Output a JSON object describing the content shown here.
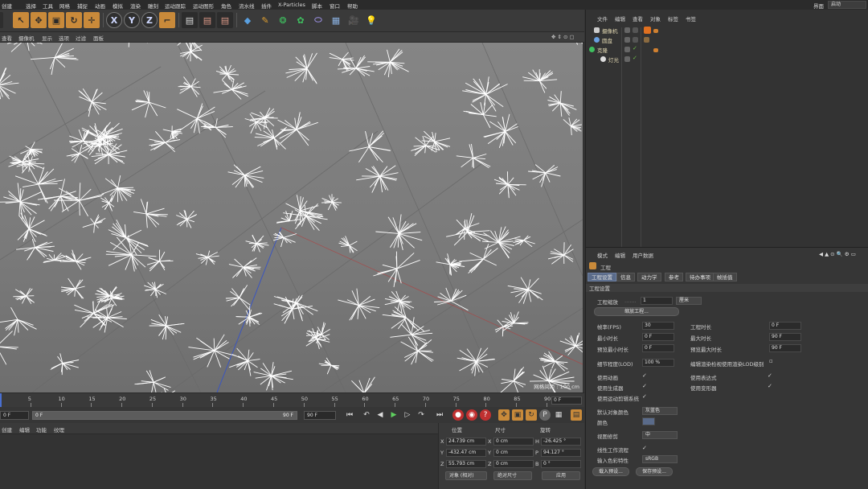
{
  "menubar": {
    "items": [
      "创建",
      "选择",
      "工具",
      "网格",
      "捕捉",
      "动画",
      "模拟",
      "渲染",
      "雕刻",
      "运动跟踪",
      "运动图形",
      "角色",
      "流水线",
      "插件",
      "X-Particles",
      "脚本",
      "窗口",
      "帮助"
    ],
    "layout_label": "界面",
    "layout_value": "启动"
  },
  "toolbar": {
    "axis_x": "X",
    "axis_y": "Y",
    "axis_z": "Z"
  },
  "viewport_menu": {
    "items": [
      "查看",
      "摄像机",
      "显示",
      "选项",
      "过滤",
      "面板"
    ]
  },
  "viewport": {
    "grid_scale": "网格间距 : 100 cm"
  },
  "timeline": {
    "ticks": [
      "0",
      "5",
      "10",
      "15",
      "20",
      "25",
      "30",
      "35",
      "40",
      "45",
      "50",
      "55",
      "60",
      "65",
      "70",
      "75",
      "80",
      "85",
      "90"
    ],
    "current_frame": "0 F"
  },
  "playbar": {
    "start_field": "0 F",
    "range_start": "0 F",
    "range_end": "90 F",
    "end_field": "90 F"
  },
  "material_menu": {
    "items": [
      "创建",
      "编辑",
      "功能",
      "纹理"
    ]
  },
  "coords": {
    "headers": [
      "位置",
      "尺寸",
      "旋转"
    ],
    "rows": [
      {
        "axis": "X",
        "pos": "24.739 cm",
        "size_axis": "X",
        "size": "0 cm",
        "rot_axis": "H",
        "rot": "-26.425 °"
      },
      {
        "axis": "Y",
        "pos": "-432.47 cm",
        "size_axis": "Y",
        "size": "0 cm",
        "rot_axis": "P",
        "rot": "94.127 °"
      },
      {
        "axis": "Z",
        "pos": "55.793 cm",
        "size_axis": "Z",
        "size": "0 cm",
        "rot_axis": "B",
        "rot": "0 °"
      }
    ],
    "mode_select": "对象 (相对)",
    "size_select": "绝对尺寸",
    "apply_button": "应用"
  },
  "object_manager": {
    "menu": [
      "文件",
      "编辑",
      "查看",
      "对象",
      "标签",
      "书签"
    ],
    "objects": [
      {
        "name": "摄像机"
      },
      {
        "name": "圆盘"
      },
      {
        "name": "克隆"
      },
      {
        "name": "灯光"
      }
    ]
  },
  "attributes": {
    "menu": [
      "模式",
      "编辑",
      "用户数据"
    ],
    "object_title": "工程",
    "tabs": [
      "工程设置",
      "信息",
      "动力学",
      "参考",
      "待办事项",
      "帧插值"
    ],
    "section": "工程设置",
    "scale_label": "工程缩放",
    "scale_value": "1",
    "scale_unit": "厘米",
    "scale_button": "缩放工程...",
    "fps_label": "帧率(FPS)",
    "fps_value": "30",
    "project_time_label": "工程时长",
    "project_time_value": "0 F",
    "min_time_label": "最小时长",
    "min_time_value": "0 F",
    "max_time_label": "最大时长",
    "max_time_value": "90 F",
    "preview_min_label": "预览最小时长",
    "preview_min_value": "0 F",
    "preview_max_label": "预览最大时长",
    "preview_max_value": "90 F",
    "lod_label": "细节程度(LOD)",
    "lod_value": "100 %",
    "render_lod_label": "编辑渲染检视使用渲染LOD级别",
    "use_anim_label": "使用动画",
    "use_expr_label": "使用表达式",
    "use_gen_label": "使用生成器",
    "use_deform_label": "使用变形器",
    "use_motion_label": "使用运动剪辑系统",
    "default_color_label": "默认对象颜色",
    "default_color_value": "灰蓝色",
    "color_label": "颜色",
    "view_clip_label": "视图修剪",
    "view_clip_value": "中",
    "linear_label": "线性工作流程",
    "input_color_label": "输入色彩特性",
    "input_color_value": "sRGB",
    "load_preset_button": "载入预设...",
    "save_preset_button": "保存预设..."
  },
  "colors": {
    "accent": "#5a6b8a",
    "object_name": "#e0d6b0",
    "check_green": "#6fbf4a"
  }
}
